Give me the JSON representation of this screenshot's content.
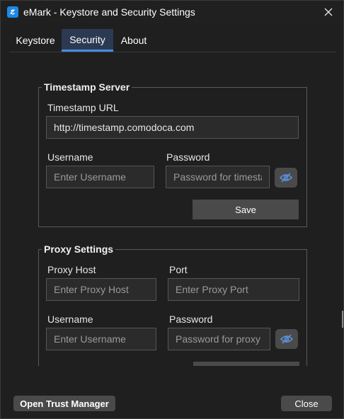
{
  "window": {
    "title": "eMark - Keystore and Security Settings"
  },
  "tabs": [
    {
      "label": "Keystore"
    },
    {
      "label": "Security"
    },
    {
      "label": "About"
    }
  ],
  "timestamp_server": {
    "legend": "Timestamp Server",
    "url_label": "Timestamp URL",
    "url_value": "http://timestamp.comodoca.com",
    "username_label": "Username",
    "username_placeholder": "Enter Username",
    "password_label": "Password",
    "password_placeholder": "Password for timestamp server",
    "save_label": "Save"
  },
  "proxy_settings": {
    "legend": "Proxy Settings",
    "host_label": "Proxy Host",
    "host_placeholder": "Enter Proxy Host",
    "port_label": "Port",
    "port_placeholder": "Enter Proxy Port",
    "username_label": "Username",
    "username_placeholder": "Enter Username",
    "password_label": "Password",
    "password_placeholder": "Password for proxy server"
  },
  "footer": {
    "trust_manager_label": "Open Trust Manager",
    "close_label": "Close"
  },
  "colors": {
    "accent": "#4a8be0",
    "tab_active_bg": "#2b3a52",
    "app_icon": "#1e88e5"
  }
}
